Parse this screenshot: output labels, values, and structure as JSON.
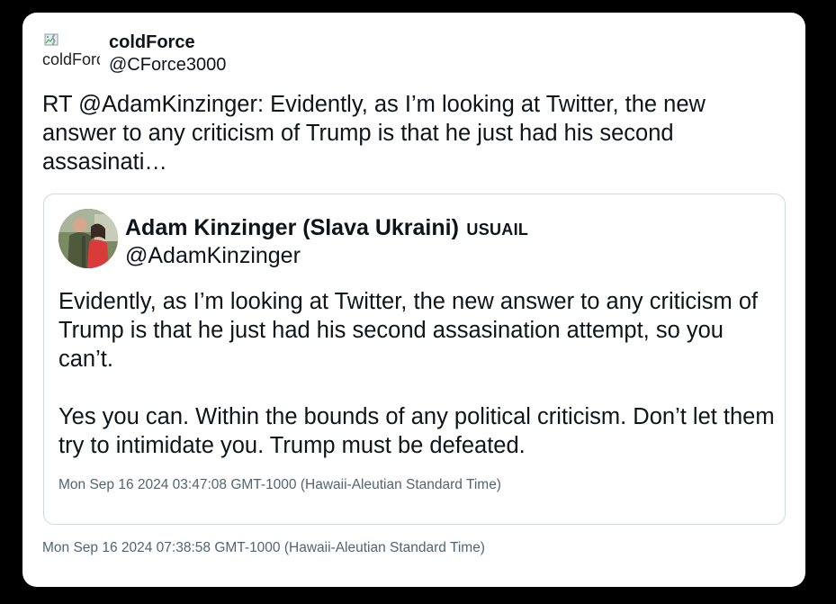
{
  "tweet": {
    "author": {
      "display_name": "coldForce",
      "handle": "@CForce3000",
      "avatar_alt": "coldForce",
      "avatar_icon": "broken-image-icon"
    },
    "text": "RT @AdamKinzinger: Evidently, as I’m looking at Twitter, the new answer to any criticism of Trump is that he just had his second assasinati…",
    "timestamp": "Mon Sep 16 2024 07:38:58 GMT-1000 (Hawaii-Aleutian Standard Time)",
    "quoted": {
      "author": {
        "display_name": "Adam Kinzinger (Slava Ukraini)",
        "affiliation": "USUAIL",
        "handle": "@AdamKinzinger"
      },
      "paragraphs": [
        "Evidently, as I’m looking at Twitter, the new answer to any criticism of Trump is that he just had his second assasination attempt, so you can’t.",
        "Yes you can. Within the bounds of any political criticism. Don’t let them try to intimidate you. Trump must be defeated."
      ],
      "timestamp": "Mon Sep 16 2024 03:47:08 GMT-1000 (Hawaii-Aleutian Standard Time)"
    }
  },
  "colors": {
    "background": "#000000",
    "card": "#ffffff",
    "text": "#0f1419",
    "muted": "#536471",
    "border": "#cfd9de"
  }
}
